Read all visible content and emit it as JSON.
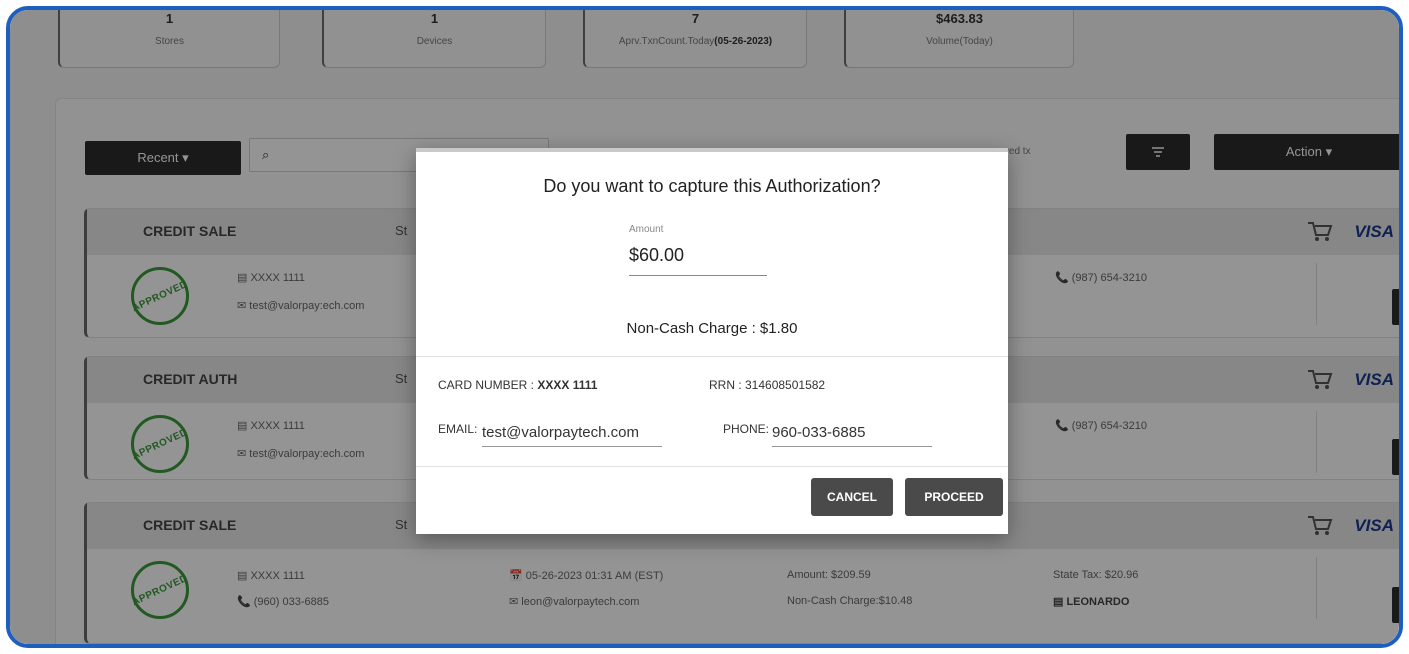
{
  "stats": [
    {
      "value": "1",
      "label": "Stores"
    },
    {
      "value": "1",
      "label": "Devices"
    },
    {
      "value": "7",
      "label_prefix": "Aprv.TxnCount.Today",
      "label_bold": "(05-26-2023)"
    },
    {
      "value": "$463.83",
      "label": "Volume(Today)"
    }
  ],
  "toolbar": {
    "recent_label": "Recent ▾",
    "search_icon": "search-icon",
    "approved_label": "roved tx",
    "filter_icon": "filter-icon",
    "action_label": "Action ▾"
  },
  "cards": [
    {
      "title": "CREDIT SALE",
      "st": "St",
      "card": "▤ XXXX 1111",
      "second": "✉ test@valorpay:ech.com",
      "phone": "📞 (987) 654-3210",
      "brand": "VISA",
      "stamp": "APPROVED"
    },
    {
      "title": "CREDIT AUTH",
      "st": "St",
      "card": "▤ XXXX 1111",
      "second": "✉ test@valorpay:ech.com",
      "phone": "📞 (987) 654-3210",
      "brand": "VISA",
      "stamp": "APPROVED"
    },
    {
      "title": "CREDIT SALE",
      "st": "St",
      "card": "▤ XXXX 1111",
      "second": "📞 (960) 033-6885",
      "brand": "VISA",
      "stamp": "APPROVED",
      "date": "📅 05-26-2023 01:31 AM (EST)",
      "email": "✉ leon@valorpaytech.com",
      "amount": "Amount: $209.59",
      "noncash": "Non-Cash Charge:$10.48",
      "statetax": "State Tax: $20.96",
      "merchant": "▤ LEONARDO"
    }
  ],
  "modal": {
    "title": "Do you want to capture this Authorization?",
    "amount_label": "Amount",
    "amount_value": "$60.00",
    "non_cash": "Non-Cash Charge : $1.80",
    "card_number_label": "CARD NUMBER : ",
    "card_number_value": "XXXX 1111",
    "rrn": "RRN : 314608501582",
    "email_label": "EMAIL:",
    "email_value": "test@valorpaytech.com",
    "phone_label": "PHONE:",
    "phone_value": "960-033-6885",
    "cancel": "CANCEL",
    "proceed": "PROCEED"
  },
  "colors": {
    "frame": "#1d5fbf",
    "approved": "#3b9a3b",
    "visa": "#1a3a8f"
  }
}
